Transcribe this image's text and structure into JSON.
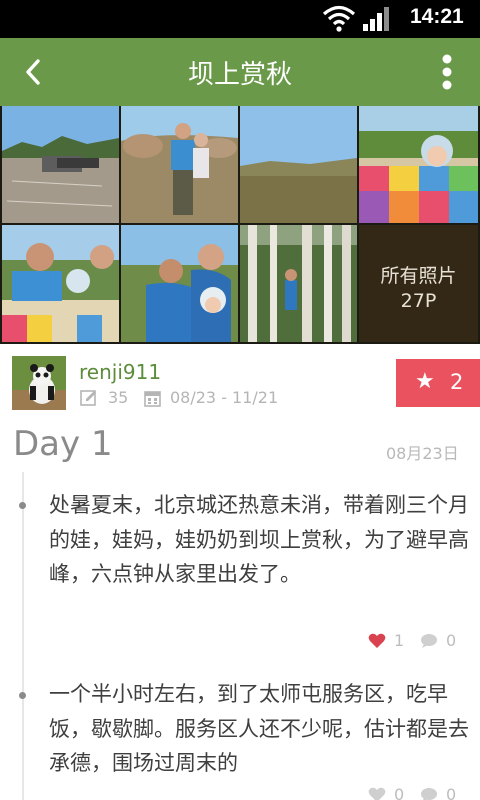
{
  "status_bar": {
    "time": "14:21",
    "wifi_icon": "wifi-icon",
    "signal_icon": "signal-icon"
  },
  "header": {
    "title": "坝上赏秋",
    "back_icon": "chevron-left-icon",
    "menu_icon": "overflow-menu-icon",
    "color": "#6a9a49"
  },
  "photos": {
    "all_photos_label": "所有照片",
    "all_photos_count": "27P"
  },
  "author": {
    "username": "renji911",
    "post_count": "35",
    "date_range": "08/23 - 11/21",
    "favorite_count": "2",
    "favorite_color": "#e9525e"
  },
  "day": {
    "title": "Day 1",
    "date": "08月23日"
  },
  "entries": [
    {
      "text": "处暑夏末，北京城还热意未消，带着刚三个月的娃，娃妈，娃奶奶到坝上赏秋，为了避早高峰，六点钟从家里出发了。",
      "likes": "1",
      "comments": "0"
    },
    {
      "text": "一个半小时左右，到了太师屯服务区，吃早饭，歇歇脚。服务区人还不少呢，估计都是去承德，围场过周末的",
      "likes": "0",
      "comments": "0"
    }
  ]
}
